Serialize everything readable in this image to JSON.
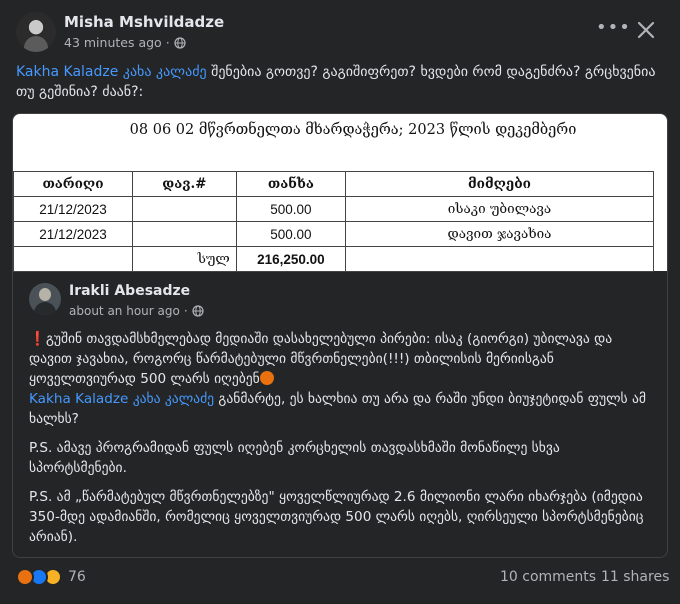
{
  "post": {
    "author": "Misha Mshvildadze",
    "time": "43 minutes ago",
    "mention": "Kakha Kaladze კახა კალაძე",
    "text": " შენებია გოთვე? გაგიშიფრეთ? ხვდები რომ დაგენძრა? გრცხვენია თუ გეშინია? ძაან?:"
  },
  "document": {
    "title": "08 06 02 მწვრთნელთა მხარდაჭერა; 2023 წლის დეკემბერი",
    "headers": [
      "თარიღი",
      "დავ.#",
      "თანხა",
      "მიმღები"
    ],
    "rows": [
      [
        "21/12/2023",
        "",
        "500.00",
        "ისაკი უბილავა"
      ],
      [
        "21/12/2023",
        "",
        "500.00",
        "დავით ჯავახია"
      ]
    ],
    "total_label": "სულ",
    "total_value": "216,250.00"
  },
  "shared_post": {
    "author": "Irakli Abesadze",
    "time": "about an hour ago",
    "exclaim": "❗",
    "para1": "გუშინ თავდამსხმელებად მედიაში დასახელებული პირები: ისაკ (გიორგი) უბილავა და დავით ჯავახია, როგორც წარმატებული მწვრთნელები(!!!) თბილისის მერიისგან ყოველთვიურად 500 ლარს იღებენ",
    "mention": "Kakha Kaladze კახა კალაძე",
    "para1b": " განმარტე, ეს ხალხია თუ არა და რაში უნდი ბიუჯეტიდან ფულს ამ ხალხს?",
    "para2": "P.S. ამავე პროგრამიდან ფულს იღებენ კორცხელის თავდასხმაში მონაწილე სხვა სპორტსმენები.",
    "para3": "P.S. ამ „წარმატებულ მწვრთნელებზე\" ყოველწლიურად 2.6 მილიონი ლარი იხარჯება (იმედია 350-მდე ადამიანში, რომელიც ყოველთვიურად 500 ლარს იღებს, ღირსეული სპორტსმენებიც არიან)."
  },
  "footer": {
    "reaction_count": "76",
    "comments": "10 comments",
    "shares": "11 shares"
  },
  "colors": {
    "background": "#242526",
    "mention": "#4599ff",
    "secondary_text": "#b0b3b8"
  },
  "icons": [
    "globe-icon",
    "more-icon",
    "close-icon",
    "angry-reaction-icon",
    "like-reaction-icon",
    "wow-reaction-icon"
  ]
}
